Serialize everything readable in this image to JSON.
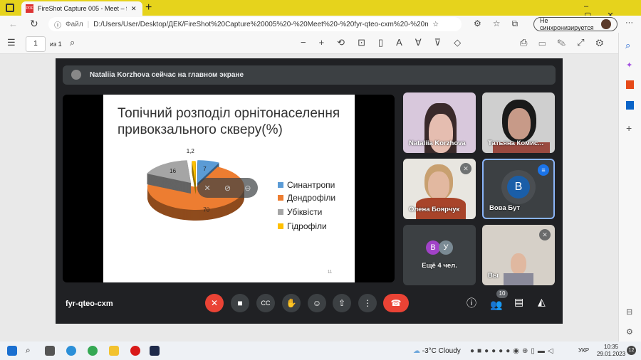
{
  "browser": {
    "tab_title": "FireShot Capture 005 - Meet – fyr",
    "new_tab": "+",
    "address_label": "Файл",
    "url": "D:/Users/User/Desktop/ДЕК/FireShot%20Capture%20005%20-%20Meet%20-%20fyr-qteo-cxm%20-%20meet.go...",
    "sync_label": "Не синхронизируется"
  },
  "pdf": {
    "page": "1",
    "page_of": "из 1"
  },
  "meet": {
    "banner": "Nataliia Korzhova сейчас на главном экране",
    "meeting_code": "fyr-qteo-cxm",
    "participants_count": "10",
    "tiles": [
      {
        "name": "Nataliia Korzhova"
      },
      {
        "name": "Татьяна Комис..."
      },
      {
        "name": "Олена Боярчук"
      },
      {
        "name": "Вова Бут",
        "initial": "B"
      },
      {
        "name": "Ещё 4 чел.",
        "initials": [
          "B",
          "У"
        ]
      },
      {
        "name": "Вы"
      }
    ]
  },
  "slide": {
    "title_line1": "Топічний розподіл орнітонаселення",
    "title_line2": "привокзального скверу(%)",
    "page_number": "11"
  },
  "chart_data": {
    "type": "pie",
    "title": "Топічний розподіл орнітонаселення привокзального скверу(%)",
    "categories": [
      "Синантропи",
      "Дендрофіли",
      "Убіквісти",
      "Гідрофіли"
    ],
    "values": [
      7,
      70,
      16,
      1.2
    ],
    "data_labels": [
      "7",
      "70",
      "16",
      "1,2"
    ],
    "colors": [
      "#5b9bd5",
      "#ed7d31",
      "#a5a5a5",
      "#ffc000"
    ],
    "legend": "right"
  },
  "taskbar": {
    "weather": "-3°C  Cloudy",
    "lang": "УКР",
    "time": "10:35",
    "date": "29.01.2023",
    "notifications": "12"
  }
}
